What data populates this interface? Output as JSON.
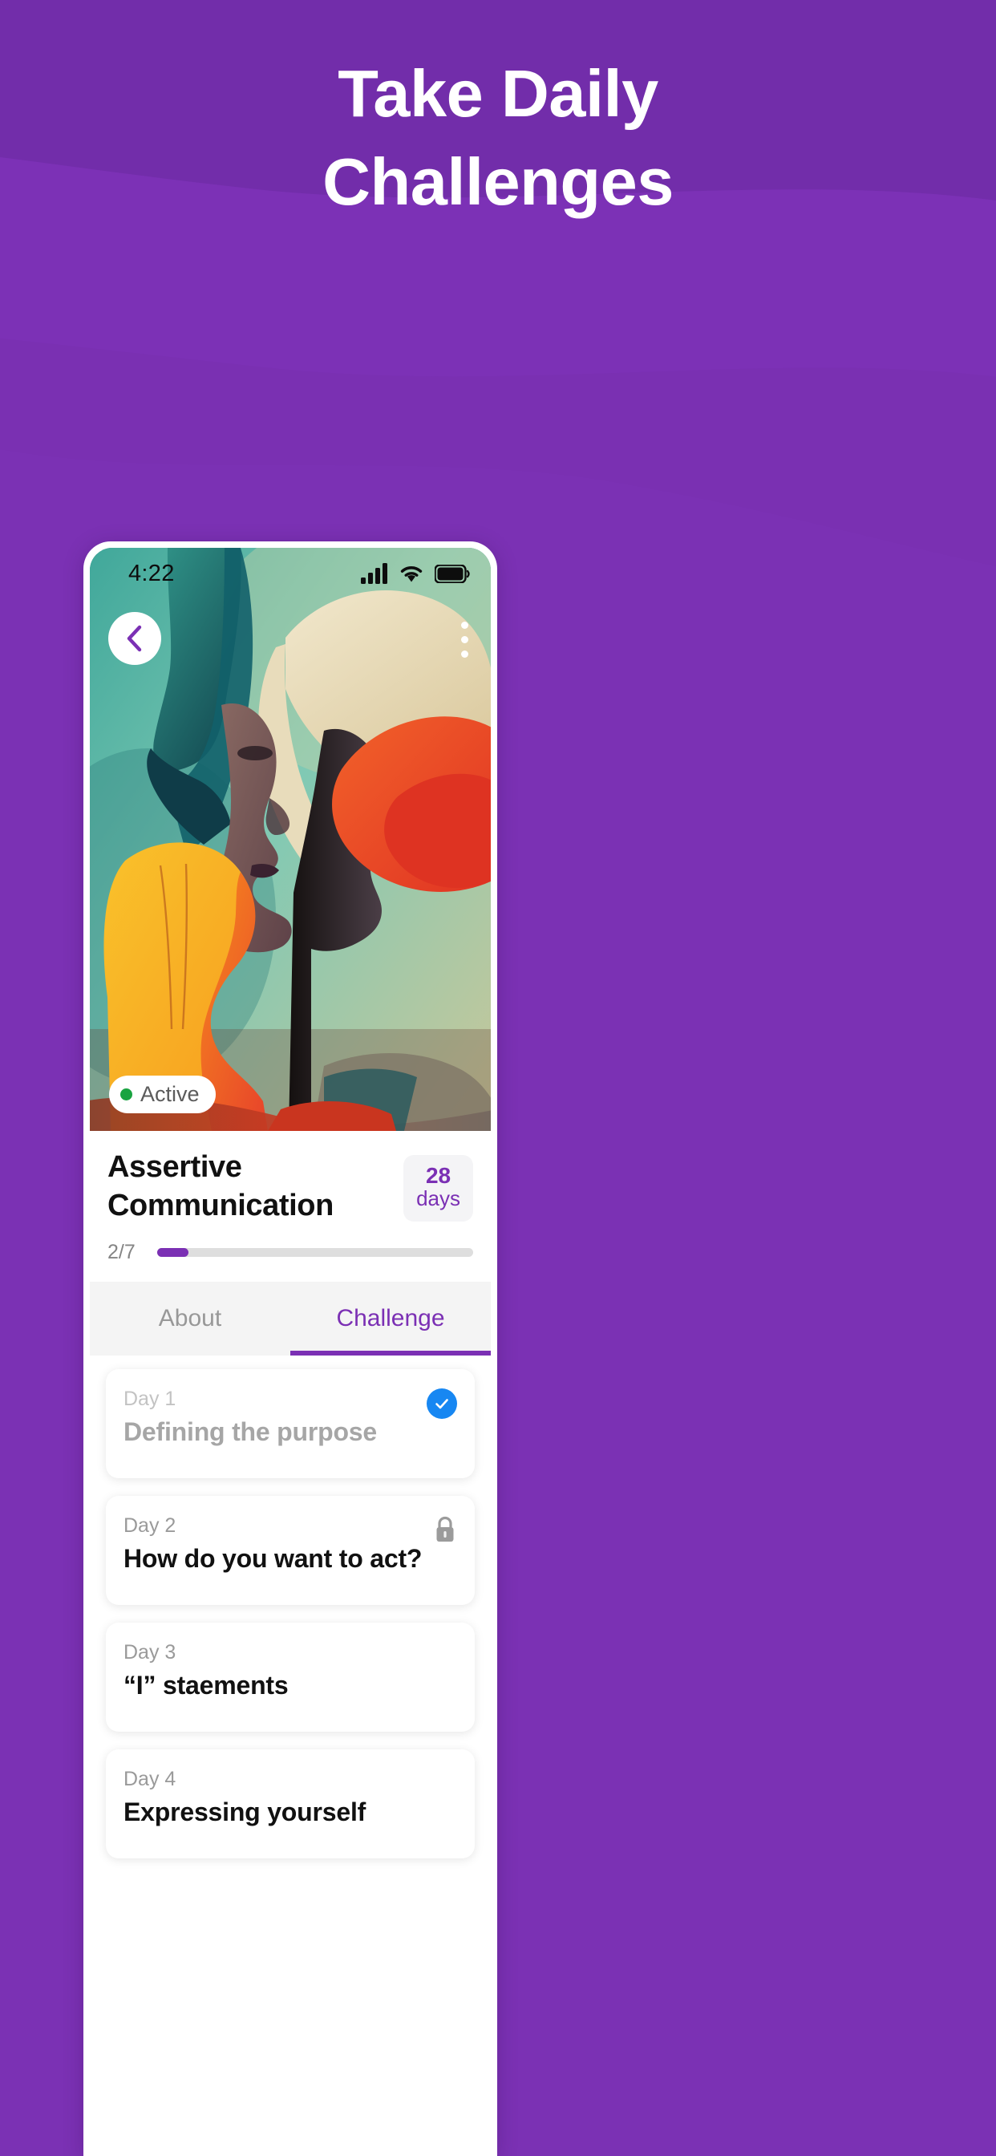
{
  "promo": {
    "headline_line1": "Take Daily",
    "headline_line2": "Challenges",
    "background_color": "#7B30B4"
  },
  "statusbar": {
    "time": "4:22",
    "signal_icon": "signal-bars-icon",
    "wifi_icon": "wifi-icon",
    "battery_icon": "battery-full-icon"
  },
  "hero": {
    "back_icon": "chevron-left-icon",
    "menu_icon": "more-vertical-icon",
    "status_badge": "Active",
    "status_dot_color": "#19A340"
  },
  "detail": {
    "title": "Assertive Communication",
    "duration_number": "28",
    "duration_unit": "days",
    "accent_color": "#7B30B4",
    "progress_label": "2/7",
    "progress_current": 2,
    "progress_total": 7,
    "progress_percent": 10
  },
  "tabs": [
    {
      "label": "About",
      "active": false
    },
    {
      "label": "Challenge",
      "active": true
    }
  ],
  "days": [
    {
      "day": "Day 1",
      "title": "Defining the purpose",
      "state": "done",
      "icon": "check-circle-icon"
    },
    {
      "day": "Day 2",
      "title": "How do you want to act?",
      "state": "locked",
      "icon": "lock-icon"
    },
    {
      "day": "Day 3",
      "title": "“I” staements",
      "state": "default",
      "icon": ""
    },
    {
      "day": "Day 4",
      "title": "Expressing yourself",
      "state": "default",
      "icon": ""
    }
  ]
}
